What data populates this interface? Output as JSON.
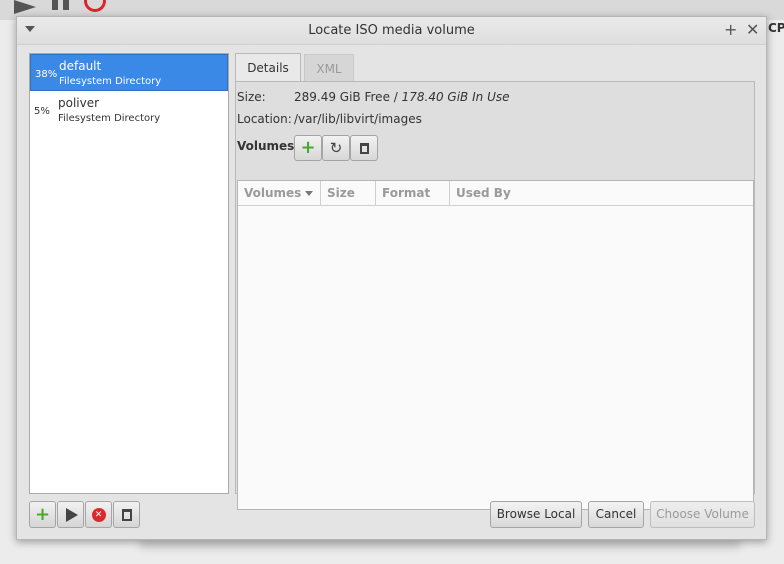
{
  "background": {
    "partial_label": "CP"
  },
  "dialog": {
    "title": "Locate ISO media volume",
    "title_buttons": {
      "maximize": "+",
      "close": "✕"
    }
  },
  "pools": [
    {
      "percent": "38%",
      "name": "default",
      "type": "Filesystem Directory",
      "selected": true
    },
    {
      "percent": "5%",
      "name": "poliver",
      "type": "Filesystem Directory",
      "selected": false
    }
  ],
  "tabs": [
    {
      "label": "Details",
      "active": true
    },
    {
      "label": "XML",
      "active": false
    }
  ],
  "details": {
    "size_label": "Size:",
    "size_free": "289.49 GiB Free / ",
    "size_used": "178.40 GiB In Use",
    "location_label": "Location:",
    "location_value": "/var/lib/libvirt/images",
    "volumes_label": "Volumes"
  },
  "volumes_table": {
    "columns": [
      "Volumes",
      "Size",
      "Format",
      "Used By"
    ],
    "sort_column": "Volumes",
    "rows": []
  },
  "buttons": {
    "browse_local": "Browse Local",
    "cancel": "Cancel",
    "choose_volume": "Choose Volume"
  },
  "colors": {
    "selection": "#3b89e6",
    "add_icon": "#4aa82e",
    "stop_icon": "#d92b2b"
  }
}
